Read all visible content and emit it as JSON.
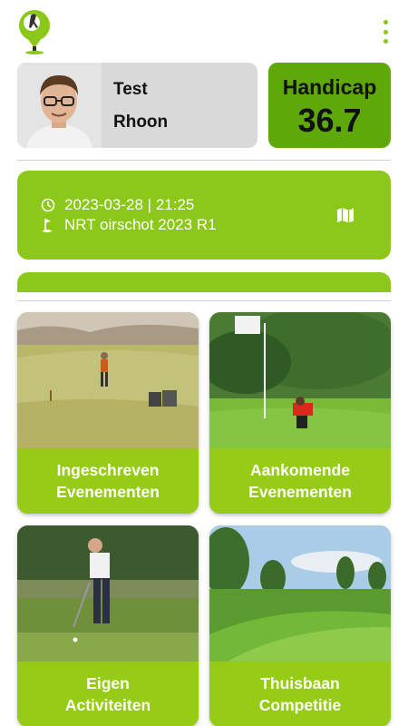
{
  "header": {
    "logo_icon": "golfer-pin-logo-icon",
    "menu_icon": "more-vertical-icon"
  },
  "profile": {
    "first_name": "Test",
    "last_name": "Rhoon",
    "avatar_icon": "user-photo"
  },
  "handicap": {
    "label": "Handicap",
    "value": "36.7"
  },
  "last_round": {
    "datetime": "2023-03-28 | 21:25",
    "course": "NRT oirschot 2023 R1",
    "clock_icon": "clock-icon",
    "flag_icon": "golf-flag-icon",
    "map_icon": "map-icon"
  },
  "tiles": [
    {
      "line1": "Ingeschreven",
      "line2": "Evenementen"
    },
    {
      "line1": "Aankomende",
      "line2": "Evenementen"
    },
    {
      "line1": "Eigen",
      "line2": "Activiteiten"
    },
    {
      "line1": "Thuisbaan",
      "line2": "Competitie"
    }
  ],
  "colors": {
    "accent": "#8cc81a",
    "handicap_bg": "#5ea80c",
    "profile_bg": "#d9d9d9"
  }
}
